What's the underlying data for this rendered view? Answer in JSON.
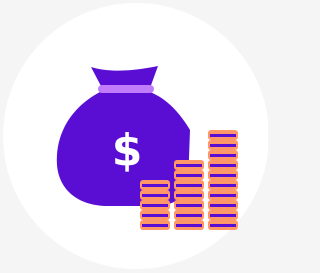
{
  "illustration": {
    "bag_symbol": "$",
    "icon_name": "money-bag-with-coin-stacks-icon",
    "coin_stacks": [
      {
        "coins": 5
      },
      {
        "coins": 7
      },
      {
        "coins": 10
      }
    ]
  },
  "colors": {
    "page_background": "#f5f5f5",
    "circle_background": "#ffffff",
    "bag": "#5a0ed3",
    "bag_tie": "#c07cfb",
    "symbol": "#ffffff",
    "coin": "#ff9768",
    "coin_stripe": "#5a0ed3"
  }
}
